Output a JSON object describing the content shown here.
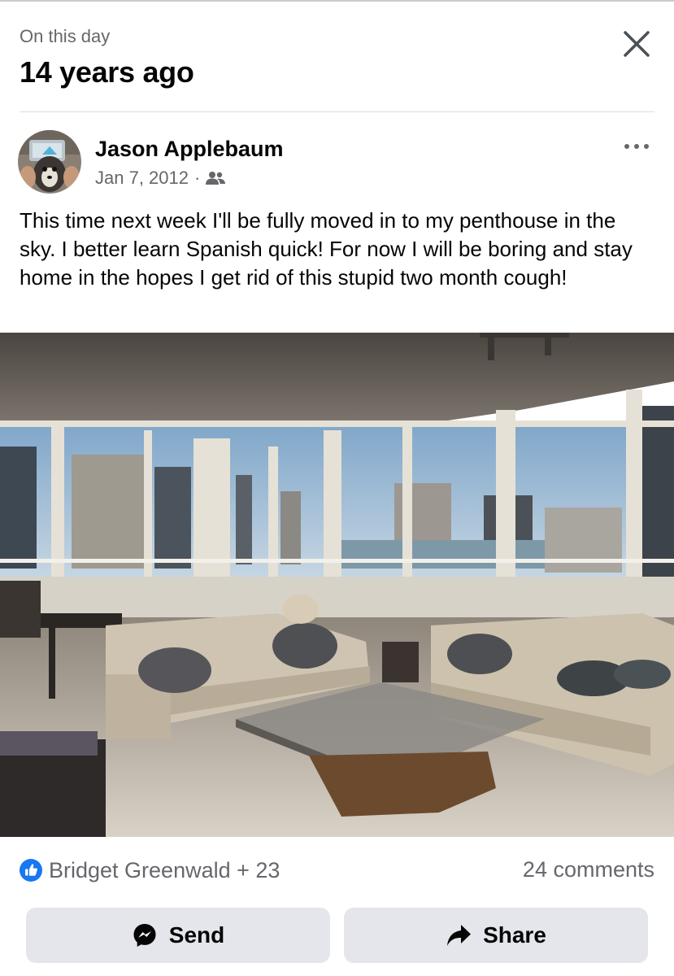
{
  "memory": {
    "eyebrow": "On this day",
    "headline": "14 years ago"
  },
  "post": {
    "author": "Jason Applebaum",
    "date": "Jan 7, 2012",
    "meta_separator": "·",
    "audience_icon": "friends-icon",
    "text": "This time next week I'll be fully moved in to my penthouse in the sky. I better learn Spanish quick! For now I will be boring and stay home in the hopes I get rid of this stupid two month cough!"
  },
  "engagement": {
    "reactions_label": "Bridget Greenwald + 23",
    "comments_label": "24 comments",
    "reaction_icon": "like-icon"
  },
  "actions": {
    "send_label": "Send",
    "share_label": "Share"
  },
  "colors": {
    "secondary_text": "#65676b",
    "like_blue": "#1877f2",
    "button_bg": "#e4e6eb"
  }
}
